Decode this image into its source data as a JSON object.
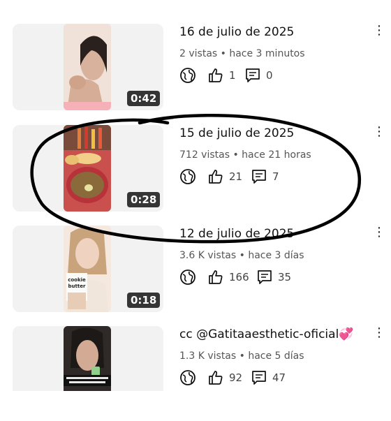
{
  "videos": [
    {
      "title": "16 de julio de 2025",
      "meta": "2 vistas • hace 3 minutos",
      "duration": "0:42",
      "likes": "1",
      "comments": "0",
      "thumb_colors": [
        "#d9b8a4",
        "#2a201d",
        "#f4e6dc"
      ]
    },
    {
      "title": "15 de julio de 2025",
      "meta": "712 vistas • hace 21 horas",
      "duration": "0:28",
      "likes": "21",
      "comments": "7",
      "thumb_colors": [
        "#b33b40",
        "#e0a050",
        "#6a7a30"
      ]
    },
    {
      "title": "12 de julio de 2025",
      "meta": "3.6 K vistas • hace 3 días",
      "duration": "0:18",
      "likes": "166",
      "comments": "35",
      "thumb_colors": [
        "#f3e3da",
        "#c9a37c",
        "#e8d5c7"
      ],
      "thumb_text": "cookie butter"
    },
    {
      "title": "cc @Gatitaaesthetic-oficial",
      "title_emoji": "💞",
      "meta": "1.3 K vistas • hace 5 días",
      "duration": "",
      "likes": "92",
      "comments": "47",
      "thumb_colors": [
        "#2f2a28",
        "#caa58e",
        "#1c1917"
      ],
      "thumb_caption": "cuando usas una mascarilla con propiedades..."
    }
  ],
  "annotation": {
    "color": "#000000",
    "highlighted_index": 1
  }
}
